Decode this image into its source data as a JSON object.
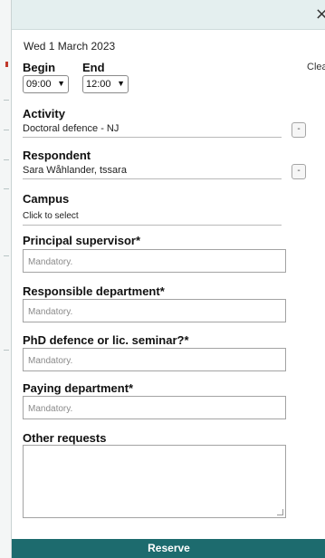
{
  "dialog": {
    "close_glyph": "×",
    "date": "Wed 1 March 2023",
    "clear": "Clear"
  },
  "time": {
    "begin_label": "Begin",
    "begin_value": "09:00",
    "end_label": "End",
    "end_value": "12:00"
  },
  "activity": {
    "label": "Activity",
    "value": "Doctoral defence - NJ",
    "button": "-"
  },
  "respondent": {
    "label": "Respondent",
    "value": "Sara Wåhlander, tssara",
    "button": "-"
  },
  "campus": {
    "label": "Campus",
    "value": "Click to select"
  },
  "fields": [
    {
      "label": "Principal supervisor*",
      "placeholder": "Mandatory."
    },
    {
      "label": "Responsible department*",
      "placeholder": "Mandatory."
    },
    {
      "label": "PhD defence or lic. seminar?*",
      "placeholder": "Mandatory."
    },
    {
      "label": "Paying department*",
      "placeholder": "Mandatory."
    }
  ],
  "other_requests": {
    "label": "Other requests",
    "value": ""
  },
  "actions": {
    "reserve": "Reserve"
  },
  "colors": {
    "header_bg": "#e4efef",
    "reserve_bg": "#1d6b6e"
  }
}
